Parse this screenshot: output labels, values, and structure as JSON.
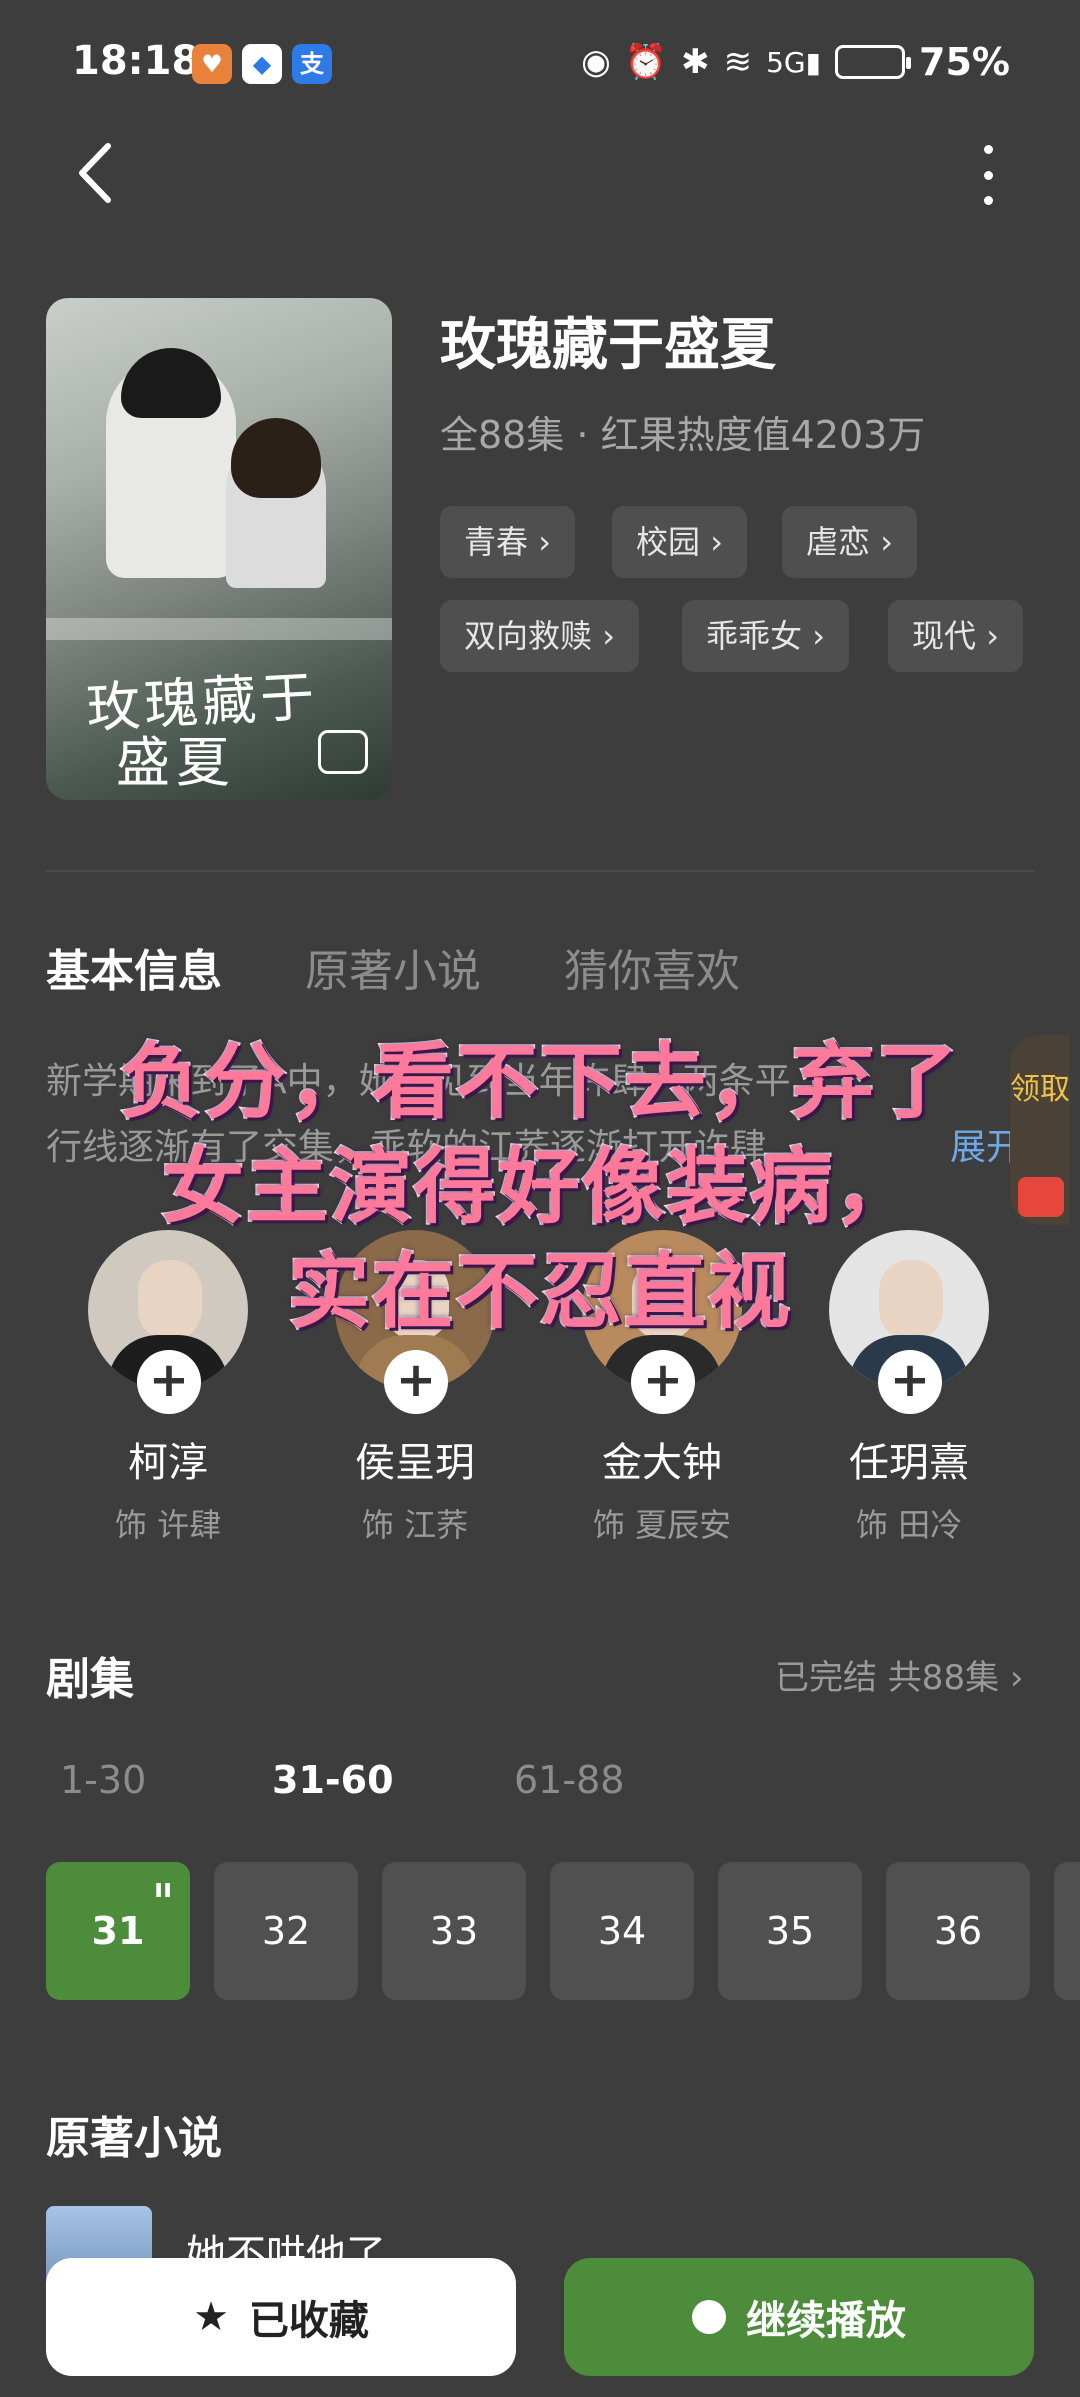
{
  "status_bar": {
    "time": "18:18",
    "apps": [
      {
        "name": "heart-app-icon",
        "glyph": "♥",
        "color": "#e8823a"
      },
      {
        "name": "blue-app-icon",
        "glyph": "◆",
        "color": "#ffffff"
      },
      {
        "name": "alipay-icon",
        "glyph": "支",
        "color": "#2e7be8"
      }
    ],
    "battery": "75%"
  },
  "show": {
    "title": "玫瑰藏于盛夏",
    "meta": "全88集 · 红果热度值4203万",
    "poster_title_1": "玫瑰藏于",
    "poster_title_2": "盛夏",
    "tags": [
      "青春",
      "校园",
      "虐恋",
      "双向救赎",
      "乖乖女",
      "现代"
    ]
  },
  "tabs": [
    "基本信息",
    "原著小说",
    "猜你喜欢"
  ],
  "description": {
    "line1": "新学期来到了A中，她再见到当年许肆，两条平",
    "line2": "行线逐渐有了交集，乖软的江荞逐渐打开许肆",
    "expand": "展开"
  },
  "reward": {
    "text": "领取"
  },
  "cast": [
    {
      "name": "柯淳",
      "role": "饰 许肆"
    },
    {
      "name": "侯呈玥",
      "role": "饰 江荞"
    },
    {
      "name": "金大钟",
      "role": "饰 夏辰安"
    },
    {
      "name": "任玥熹",
      "role": "饰 田冷"
    }
  ],
  "episodes": {
    "title": "剧集",
    "status": "已完结 共88集 ›",
    "ranges": [
      "1-30",
      "31-60",
      "61-88"
    ],
    "items": [
      "31",
      "32",
      "33",
      "34",
      "35",
      "36"
    ],
    "playing_indicator": "ıı"
  },
  "novel": {
    "section_title": "原著小说",
    "title": "她不哄他了"
  },
  "caption": {
    "line1": "负分，看不下去，弃了",
    "line2": "女主演得好像装病，",
    "line3": "实在不忍直视"
  },
  "buttons": {
    "collect": "已收藏",
    "play": "继续播放"
  },
  "colors": {
    "background": "#3d3d3d",
    "accent_green": "#4c8c3a",
    "caption_pink": "#ff7a9a"
  }
}
